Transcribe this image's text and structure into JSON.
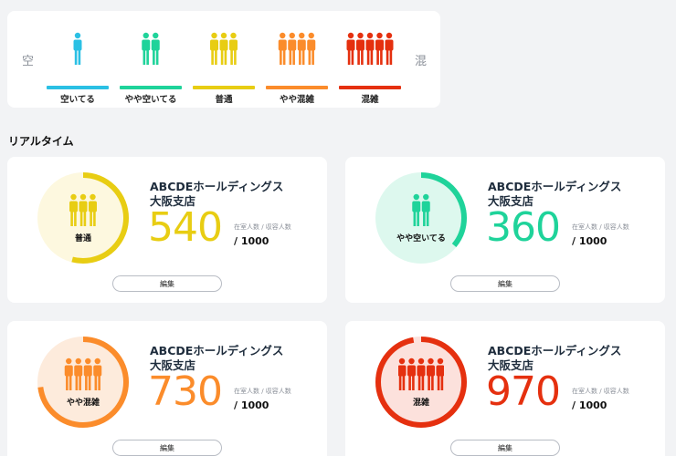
{
  "legend": {
    "left_label": "空",
    "right_label": "混",
    "levels": [
      {
        "label": "空いてる",
        "color": "#2bc0e4",
        "people": 1
      },
      {
        "label": "やや空いてる",
        "color": "#1fd39a",
        "people": 2
      },
      {
        "label": "普通",
        "color": "#e8cd13",
        "people": 3
      },
      {
        "label": "やや混雑",
        "color": "#fb8c2b",
        "people": 4
      },
      {
        "label": "混雑",
        "color": "#e5300f",
        "people": 5
      }
    ]
  },
  "section_title": "リアルタイム",
  "cards": [
    {
      "store_line1": "ABCDEホールディングス",
      "store_line2": "大阪支店",
      "count": "540",
      "capacity": "/ 1000",
      "unit_label": "在室人数 / 収容人数",
      "level_label": "普通",
      "color": "#e8cd13",
      "bg": "#fdf8df",
      "people": 3,
      "fill": 0.54,
      "edit_label": "編集"
    },
    {
      "store_line1": "ABCDEホールディングス",
      "store_line2": "大阪支店",
      "count": "360",
      "capacity": "/ 1000",
      "unit_label": "在室人数 / 収容人数",
      "level_label": "やや空いてる",
      "color": "#1fd39a",
      "bg": "#ddf8ee",
      "people": 2,
      "fill": 0.36,
      "edit_label": "編集"
    },
    {
      "store_line1": "ABCDEホールディングス",
      "store_line2": "大阪支店",
      "count": "730",
      "capacity": "/ 1000",
      "unit_label": "在室人数 / 収容人数",
      "level_label": "やや混雑",
      "color": "#fb8c2b",
      "bg": "#fdebdc",
      "people": 4,
      "fill": 0.73,
      "edit_label": "編集"
    },
    {
      "store_line1": "ABCDEホールディングス",
      "store_line2": "大阪支店",
      "count": "970",
      "capacity": "/ 1000",
      "unit_label": "在室人数 / 収容人数",
      "level_label": "混雑",
      "color": "#e5300f",
      "bg": "#fce1dc",
      "people": 5,
      "fill": 0.97,
      "edit_label": "編集"
    }
  ]
}
